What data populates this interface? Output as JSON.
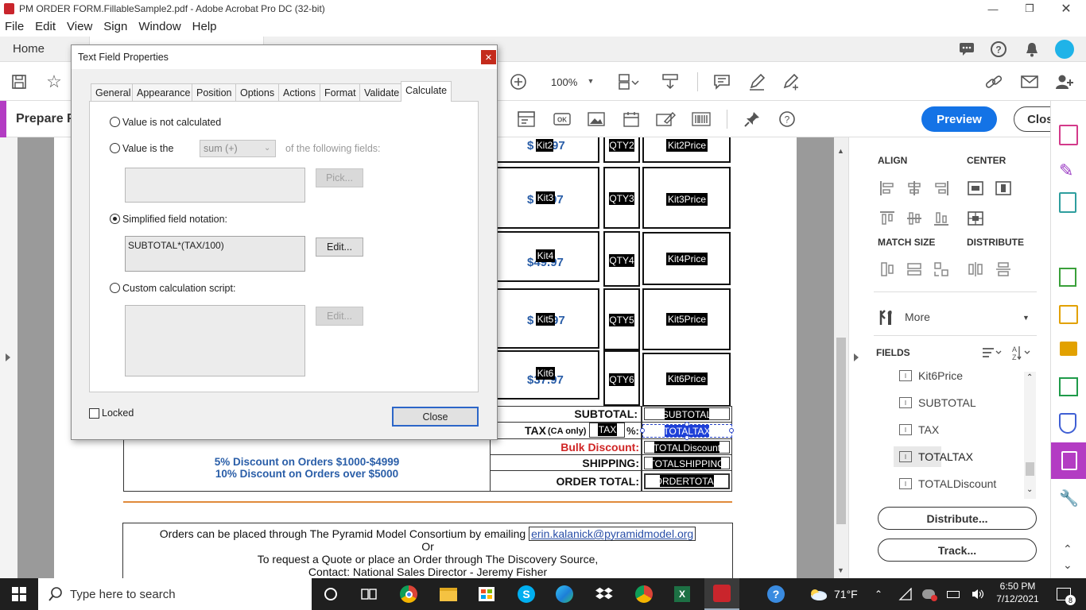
{
  "window": {
    "title": "PM ORDER FORM.FillableSample2.pdf - Adobe Acrobat Pro DC (32-bit)"
  },
  "menu": [
    "File",
    "Edit",
    "View",
    "Sign",
    "Window",
    "Help"
  ],
  "tabs": {
    "home": "Home"
  },
  "toolbar": {
    "zoom": "100%"
  },
  "prepare": {
    "title": "Prepare F",
    "preview": "Preview",
    "close": "Close"
  },
  "dialog": {
    "title": "Text Field Properties",
    "tabs": [
      "General",
      "Appearance",
      "Position",
      "Options",
      "Actions",
      "Format",
      "Validate",
      "Calculate"
    ],
    "active_tab": "Calculate",
    "options": {
      "not_calculated": "Value is not calculated",
      "value_is_the": "Value is the",
      "sum_select": "sum (+)",
      "following_fields": "of the following fields:",
      "pick": "Pick...",
      "simplified": "Simplified field notation:",
      "formula": "SUBTOTAL*(TAX/100)",
      "edit": "Edit...",
      "custom": "Custom calculation script:",
      "edit2": "Edit..."
    },
    "locked": "Locked",
    "close": "Close"
  },
  "document": {
    "rows": [
      {
        "price": "$",
        "price2": "97",
        "kit": "Kit2",
        "qty": "QTY2",
        "total": "Kit2Price"
      },
      {
        "price": "$",
        "price2": "97",
        "kit": "Kit3",
        "qty": "QTY3",
        "total": "Kit3Price"
      },
      {
        "price": "$49.97",
        "price2": "",
        "kit": "Kit4",
        "qty": "QTY4",
        "total": "Kit4Price"
      },
      {
        "price": "$",
        "price2": "97",
        "kit": "Kit5",
        "qty": "QTY5",
        "total": "Kit5Price"
      },
      {
        "price": "$37.97",
        "price2": "",
        "kit": "Kit6",
        "qty": "QTY6",
        "total": "Kit6Price"
      }
    ],
    "totals": {
      "subtotal_label": "SUBTOTAL:",
      "subtotal_field": "SUBTOTAL",
      "tax_label": "TAX",
      "tax_note": "(CA only)",
      "tax_field": "TAX",
      "pct": "%:",
      "totaltax_field": "TOTALTAX",
      "bulk_label": "Bulk Discount:",
      "bulk_field": "TOTALDiscount",
      "shipping_label": "SHIPPING:",
      "shipping_field": "TOTALSHIPPING",
      "order_label": "ORDER TOTAL:",
      "order_field": "ORDERTOTAL"
    },
    "discounts": [
      "5% Discount on Orders $1000-$4999",
      "10% Discount on Orders over $5000"
    ],
    "footer": {
      "line1": "Orders can be placed through The Pyramid Model Consortium by emailing",
      "email": "erin.kalanick@pyramidmodel.org",
      "or": "Or",
      "line3": "To request a Quote or place an Order through The Discovery Source,",
      "line4": "Contact: National Sales Director - Jeremy Fisher"
    }
  },
  "panel": {
    "align": "ALIGN",
    "center": "CENTER",
    "match_size": "MATCH SIZE",
    "distribute": "DISTRIBUTE",
    "more": "More",
    "fields_header": "FIELDS",
    "fields": [
      "Kit6Price",
      "SUBTOTAL",
      "TAX",
      "TOTALTAX",
      "TOTALDiscount"
    ],
    "selected_field": "TOTALTAX",
    "distribute_btn": "Distribute...",
    "track_btn": "Track..."
  },
  "taskbar": {
    "search": "Type here to search",
    "weather": "71°F",
    "time": "6:50 PM",
    "date": "7/12/2021",
    "notif": "8"
  }
}
